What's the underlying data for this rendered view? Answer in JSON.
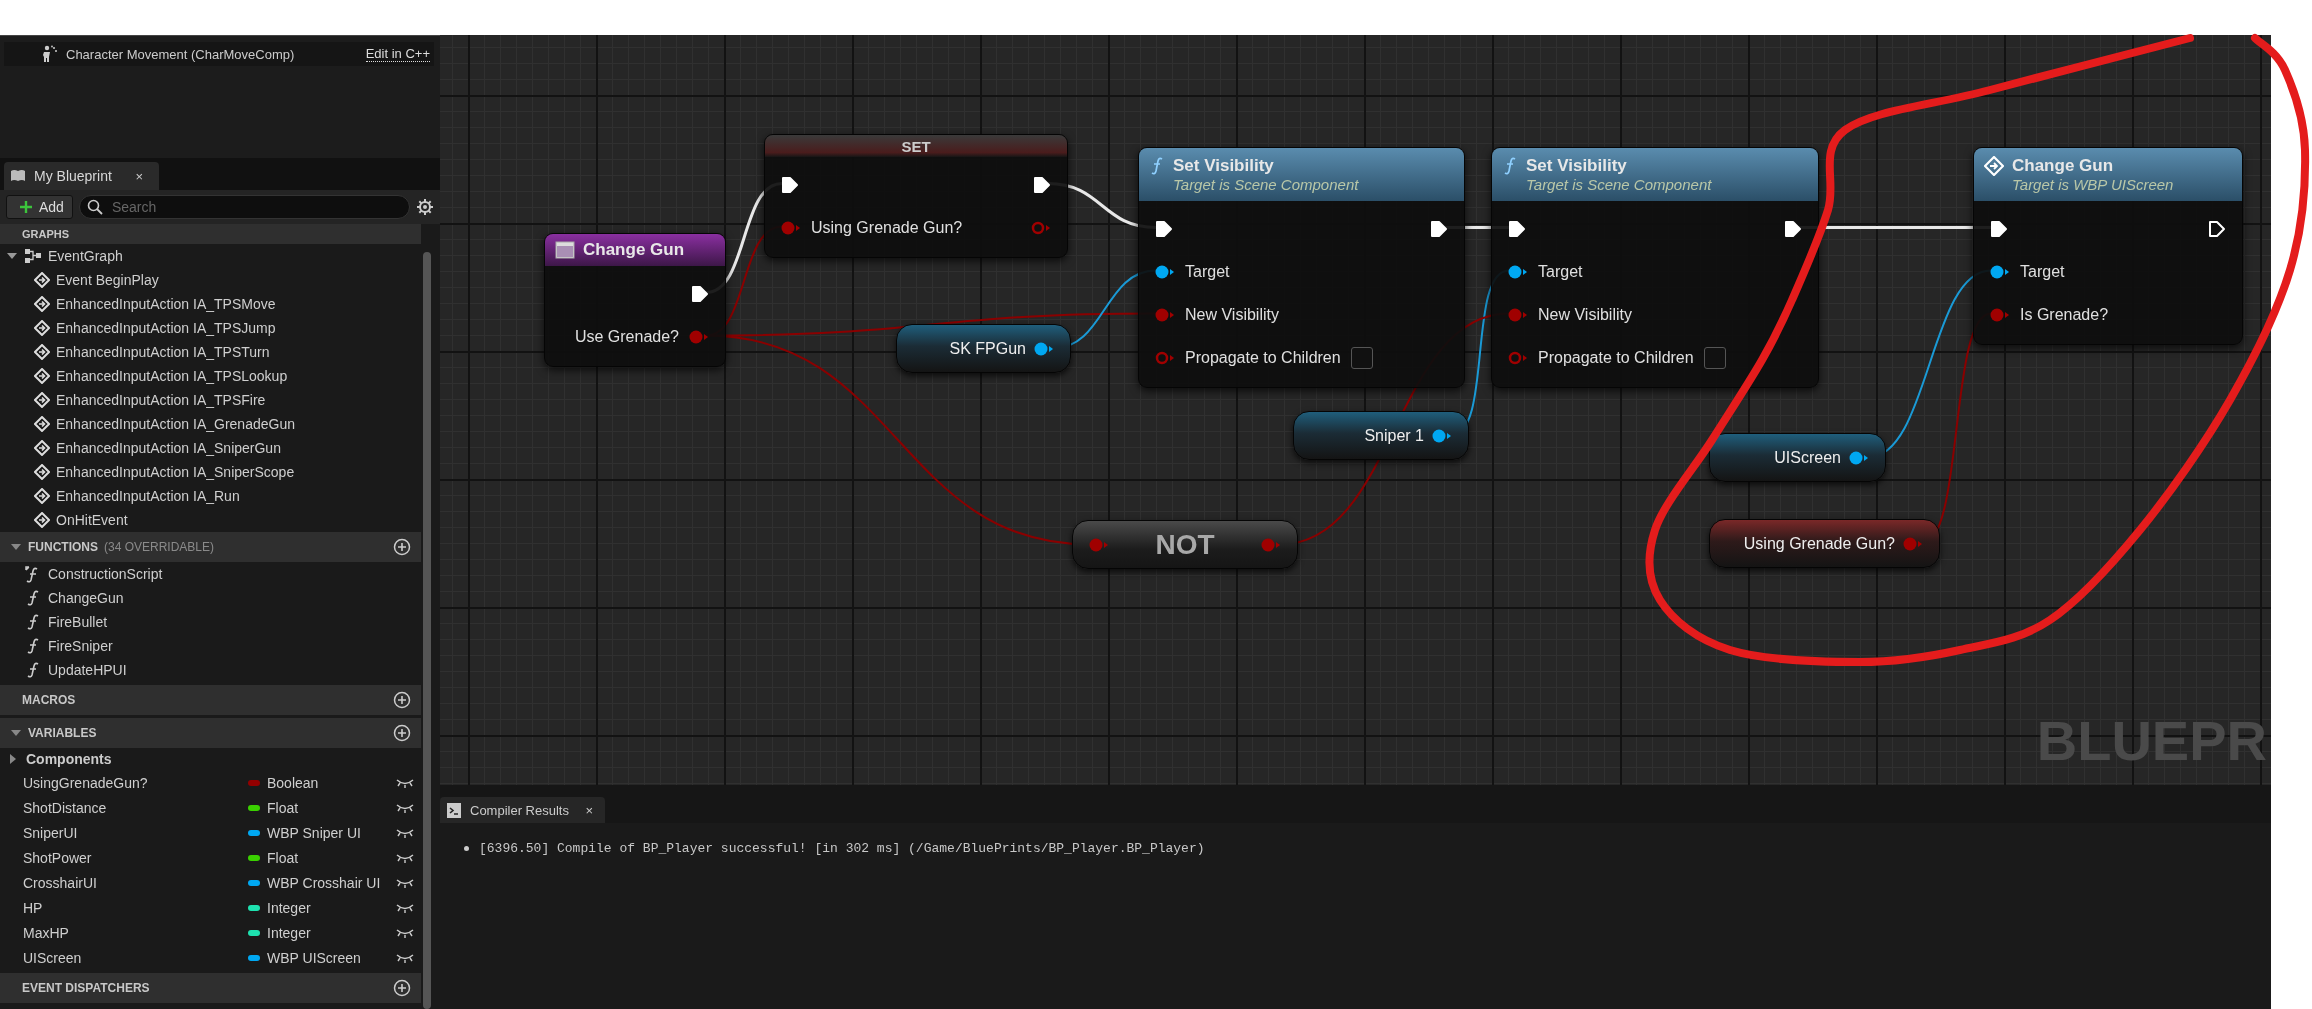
{
  "details": {
    "component": {
      "label": "Character Movement (CharMoveComp)",
      "link": "Edit in C++"
    }
  },
  "my_blueprint": {
    "tab": {
      "title": "My Blueprint",
      "close": "×",
      "selected": true
    },
    "add_button": "Add",
    "search": {
      "placeholder": "Search"
    },
    "graphs": {
      "header": "GRAPHS",
      "items": [
        {
          "label": "EventGraph",
          "expanded": true,
          "children": [
            {
              "label": "Event BeginPlay"
            },
            {
              "label": "EnhancedInputAction IA_TPSMove"
            },
            {
              "label": "EnhancedInputAction IA_TPSJump"
            },
            {
              "label": "EnhancedInputAction IA_TPSTurn"
            },
            {
              "label": "EnhancedInputAction IA_TPSLookup"
            },
            {
              "label": "EnhancedInputAction IA_TPSFire"
            },
            {
              "label": "EnhancedInputAction IA_GrenadeGun"
            },
            {
              "label": "EnhancedInputAction IA_SniperGun"
            },
            {
              "label": "EnhancedInputAction IA_SniperScope"
            },
            {
              "label": "EnhancedInputAction IA_Run"
            },
            {
              "label": "OnHitEvent"
            }
          ]
        }
      ]
    },
    "functions": {
      "header": "FUNCTIONS",
      "note": "(34 OVERRIDABLE)",
      "expanded": true,
      "items": [
        {
          "label": "ConstructionScript",
          "kind": "construction"
        },
        {
          "label": "ChangeGun",
          "kind": "function"
        },
        {
          "label": "FireBullet",
          "kind": "function"
        },
        {
          "label": "FireSniper",
          "kind": "function"
        },
        {
          "label": "UpdateHPUI",
          "kind": "function"
        }
      ]
    },
    "macros": {
      "header": "MACROS"
    },
    "variables": {
      "header": "VARIABLES",
      "expanded": true,
      "categories": [
        {
          "label": "Components",
          "expanded": false
        }
      ],
      "items": [
        {
          "name": "UsingGrenadeGun?",
          "type": "Boolean",
          "color": "#930000"
        },
        {
          "name": "ShotDistance",
          "type": "Float",
          "color": "#3ad000"
        },
        {
          "name": "SniperUI",
          "type": "WBP Sniper UI",
          "color": "#00a8f2"
        },
        {
          "name": "ShotPower",
          "type": "Float",
          "color": "#3ad000"
        },
        {
          "name": "CrosshairUI",
          "type": "WBP Crosshair UI",
          "color": "#00a8f2"
        },
        {
          "name": "HP",
          "type": "Integer",
          "color": "#1ee2b0"
        },
        {
          "name": "MaxHP",
          "type": "Integer",
          "color": "#1ee2b0"
        },
        {
          "name": "UIScreen",
          "type": "WBP UIScreen",
          "color": "#00a8f2"
        }
      ]
    },
    "event_dispatchers": {
      "header": "EVENT DISPATCHERS"
    }
  },
  "graph": {
    "nodes": [
      {
        "kind": "event",
        "title": "Change Gun",
        "outputs": [
          {
            "kind": "exec",
            "connected": true
          },
          {
            "kind": "bool",
            "label": "Use Grenade?",
            "connected": true
          }
        ]
      },
      {
        "kind": "set",
        "title": "SET",
        "inputs": [
          {
            "kind": "exec",
            "connected": true
          },
          {
            "kind": "bool",
            "label": "Using Grenade Gun?",
            "connected": true
          }
        ],
        "outputs": [
          {
            "kind": "exec",
            "connected": true
          },
          {
            "kind": "bool",
            "connected": false
          }
        ]
      },
      {
        "kind": "function",
        "title": "Set Visibility",
        "subtitle": "Target is Scene Component",
        "inputs": [
          {
            "kind": "exec",
            "connected": true
          },
          {
            "kind": "object",
            "label": "Target",
            "connected": true
          },
          {
            "kind": "bool",
            "label": "New Visibility",
            "connected": true
          },
          {
            "kind": "bool",
            "label": "Propagate to Children",
            "connected": false,
            "checked": false
          }
        ],
        "outputs": [
          {
            "kind": "exec",
            "connected": true
          }
        ]
      },
      {
        "kind": "function",
        "title": "Set Visibility",
        "subtitle": "Target is Scene Component",
        "inputs": [
          {
            "kind": "exec",
            "connected": true
          },
          {
            "kind": "object",
            "label": "Target",
            "connected": true
          },
          {
            "kind": "bool",
            "label": "New Visibility",
            "connected": true
          },
          {
            "kind": "bool",
            "label": "Propagate to Children",
            "connected": false,
            "checked": false
          }
        ],
        "outputs": [
          {
            "kind": "exec",
            "connected": true
          }
        ]
      },
      {
        "kind": "message",
        "title": "Change Gun",
        "subtitle": "Target is WBP UIScreen",
        "inputs": [
          {
            "kind": "exec",
            "connected": true
          },
          {
            "kind": "object",
            "label": "Target",
            "connected": true
          },
          {
            "kind": "bool",
            "label": "Is Grenade?",
            "connected": true
          }
        ],
        "outputs": [
          {
            "kind": "exec",
            "connected": false
          }
        ]
      },
      {
        "kind": "variable",
        "title": "SK FPGun",
        "outputs": [
          {
            "kind": "object",
            "connected": true
          }
        ]
      },
      {
        "kind": "variable",
        "title": "Sniper 1",
        "outputs": [
          {
            "kind": "object",
            "connected": true
          }
        ]
      },
      {
        "kind": "not",
        "title": "NOT",
        "inputs": [
          {
            "kind": "bool",
            "connected": true
          }
        ],
        "outputs": [
          {
            "kind": "bool",
            "connected": true
          }
        ]
      },
      {
        "kind": "variable",
        "title": "UIScreen",
        "outputs": [
          {
            "kind": "object",
            "connected": true
          }
        ]
      },
      {
        "kind": "variable",
        "title": "Using Grenade Gun?",
        "outputs": [
          {
            "kind": "bool",
            "connected": true
          }
        ]
      }
    ],
    "watermark": "BLUEPR"
  },
  "compiler_results": {
    "tab": {
      "title": "Compiler Results",
      "close": "×",
      "selected": true
    },
    "messages": [
      "[6396.50] Compile of BP_Player successful! [in 302 ms] (/Game/BluePrints/BP_Player.BP_Player)"
    ]
  }
}
